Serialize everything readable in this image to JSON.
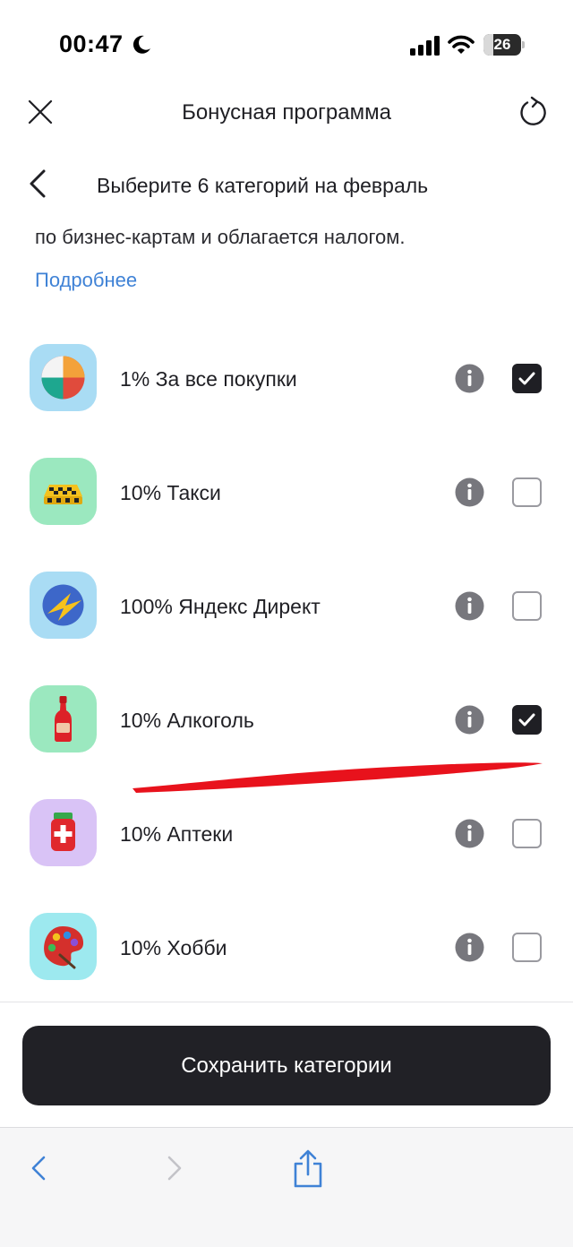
{
  "status_bar": {
    "time": "00:47",
    "battery_level": "26",
    "battery_fraction": 0.26,
    "icons": [
      "moon-icon",
      "signal-icon",
      "wifi-icon",
      "battery-icon"
    ]
  },
  "topbar": {
    "title": "Бонусная программа",
    "icons": [
      "close-icon",
      "refresh-icon"
    ]
  },
  "subbar": {
    "title": "Выберите 6 категорий на февраль",
    "icons": [
      "back-icon"
    ]
  },
  "description": {
    "text": "по бизнес-картам и облагается налогом.",
    "more_link": "Подробнее"
  },
  "categories": [
    {
      "label": "1% За все покупки",
      "checked": true,
      "icon": "pie-chart-icon",
      "icon_bg": "#a9dcf4"
    },
    {
      "label": "10% Такси",
      "checked": false,
      "icon": "taxi-icon",
      "icon_bg": "#9be8bf"
    },
    {
      "label": "100% Яндекс Директ",
      "checked": false,
      "icon": "yandex-direct-icon",
      "icon_bg": "#a9dcf4"
    },
    {
      "label": "10% Алкоголь",
      "checked": true,
      "icon": "bottle-icon",
      "icon_bg": "#9be8bf"
    },
    {
      "label": "10% Аптеки",
      "checked": false,
      "icon": "pharmacy-icon",
      "icon_bg": "#d9c3f6"
    },
    {
      "label": "10% Хобби",
      "checked": false,
      "icon": "palette-icon",
      "icon_bg": "#9de9ef"
    }
  ],
  "save_button": {
    "label": "Сохранить категории"
  },
  "browser_bar": {
    "icons": [
      "nav-back-icon",
      "nav-forward-icon",
      "share-icon"
    ]
  },
  "colors": {
    "accent_link": "#3f82d6",
    "button_dark": "#212126",
    "annotation_red": "#e8121c"
  }
}
